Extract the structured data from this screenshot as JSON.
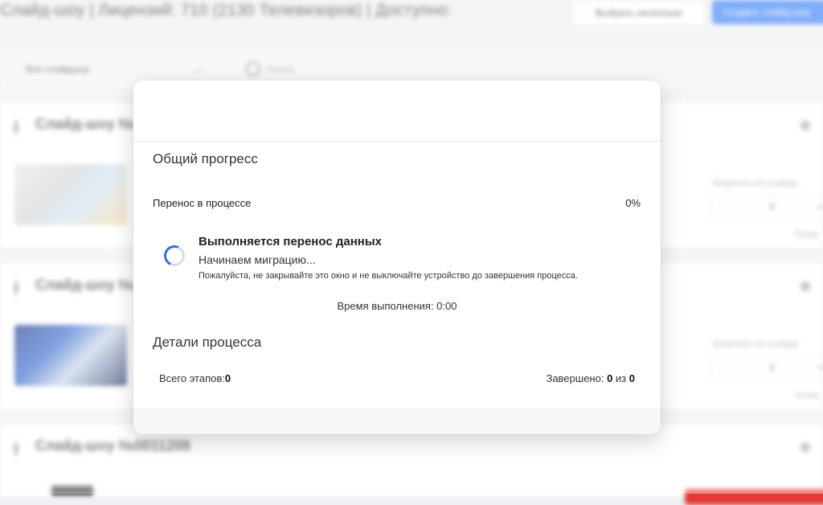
{
  "background": {
    "title": "Слайд-шоу | Лицензий: 710 (2130 Телевизоров) | Доступно:",
    "select_multiple_label": "Выбрать несколько",
    "create_label": "Создать слайд-шоу",
    "filter_select_value": "Все слайдшоу",
    "search_placeholder": "Поиск",
    "cards": [
      {
        "name": "Слайд-шоу №",
        "licenses_label": "Лицензии на слайдш",
        "licenses_value": "3",
        "minus": "-",
        "plus": "+",
        "tv_label": "Телев"
      },
      {
        "name": "Слайд-шоу №",
        "licenses_label": "Лицензии на слайдш",
        "licenses_value": "3",
        "minus": "-",
        "plus": "+",
        "tv_label": "Телев"
      },
      {
        "name": "Слайд-шоу №0011208"
      }
    ]
  },
  "modal": {
    "overall_title": "Общий прогресс",
    "progress_label": "Перенос в процессе",
    "progress_percent_text": "0%",
    "progress_value": 0,
    "status_title": "Выполняется перенос данных",
    "status_subtitle": "Начинаем миграцию...",
    "status_warning": "Пожалуйста, не закрывайте это окно и не выключайте устройство до завершения процесса.",
    "elapsed_label": "Время выполнения: ",
    "elapsed_value": "0:00",
    "details_title": "Детали процесса",
    "total_steps_label": "Всего этапов:",
    "total_steps_value": "0",
    "completed_label": "Завершено: ",
    "completed_value": "0",
    "completed_of": " из ",
    "completed_total": "0"
  },
  "colors": {
    "accent": "#3b82f6",
    "danger": "#e53935"
  }
}
